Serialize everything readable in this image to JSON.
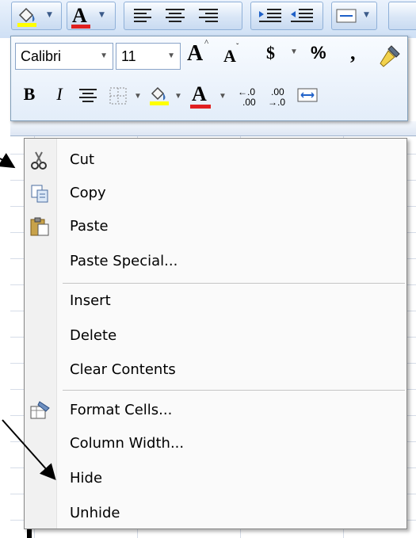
{
  "mini_toolbar": {
    "font_name": "Calibri",
    "font_size": "11",
    "currency_symbol": "$",
    "percent_symbol": "%",
    "comma_symbol": ",",
    "bold": "B",
    "italic": "I",
    "font_color_glyph": "A",
    "increase_font_glyph": "A",
    "decrease_font_glyph": "A"
  },
  "ribbon_top": {
    "font_color_glyph": "A"
  },
  "context_menu": {
    "items": [
      {
        "label": "Cut",
        "icon": "scissors-icon"
      },
      {
        "label": "Copy",
        "icon": "copy-icon"
      },
      {
        "label": "Paste",
        "icon": "clipboard-icon"
      },
      {
        "label": "Paste Special...",
        "icon": ""
      },
      {
        "label": "Insert",
        "icon": ""
      },
      {
        "label": "Delete",
        "icon": ""
      },
      {
        "label": "Clear Contents",
        "icon": ""
      },
      {
        "label": "Format Cells...",
        "icon": "format-cells-icon"
      },
      {
        "label": "Column Width...",
        "icon": ""
      },
      {
        "label": "Hide",
        "icon": ""
      },
      {
        "label": "Unhide",
        "icon": ""
      }
    ]
  },
  "colors": {
    "font_color_red": "#e02020",
    "highlight_yellow": "#ffff00",
    "menu_border": "#868686",
    "ribbon_blue": "#cfe0f5"
  }
}
